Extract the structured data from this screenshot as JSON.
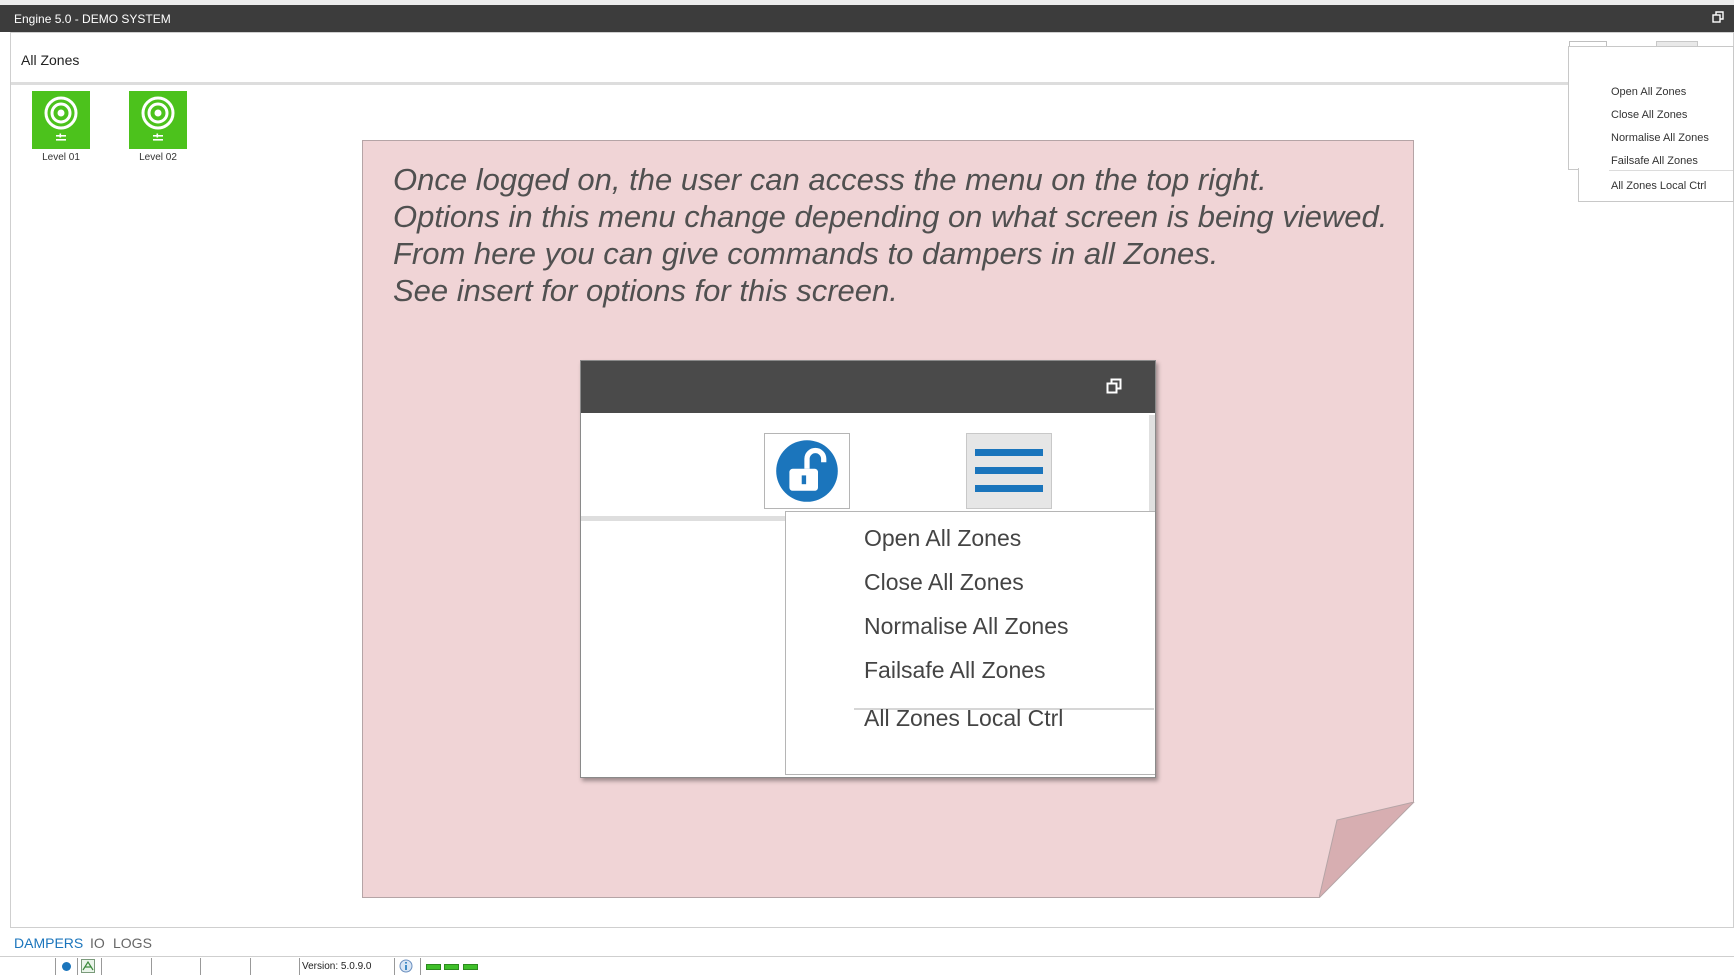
{
  "window": {
    "title": "Engine 5.0 - DEMO SYSTEM"
  },
  "header": {
    "title": "All Zones"
  },
  "menu": {
    "items": [
      "Open All Zones",
      "Close All Zones",
      "Normalise All Zones",
      "Failsafe All Zones"
    ],
    "last_item": "All Zones Local Ctrl"
  },
  "levels": [
    {
      "label": "Level 01"
    },
    {
      "label": "Level 02"
    }
  ],
  "note": {
    "lines": [
      "Once logged on, the user can access the menu on the top right.",
      "Options in this menu change depending on what screen is being viewed.",
      "From here you can give commands to dampers in all Zones.",
      "See insert for options for this screen."
    ]
  },
  "tabs": {
    "dampers": "DAMPERS",
    "io": "IO",
    "logs": "LOGS"
  },
  "status": {
    "version": "Version: 5.0.9.0"
  },
  "colors": {
    "accent_blue": "#1b75bc",
    "tile_green": "#4cc21c",
    "note_pink": "#f0d4d6",
    "titlebar": "#3c3c3c"
  }
}
